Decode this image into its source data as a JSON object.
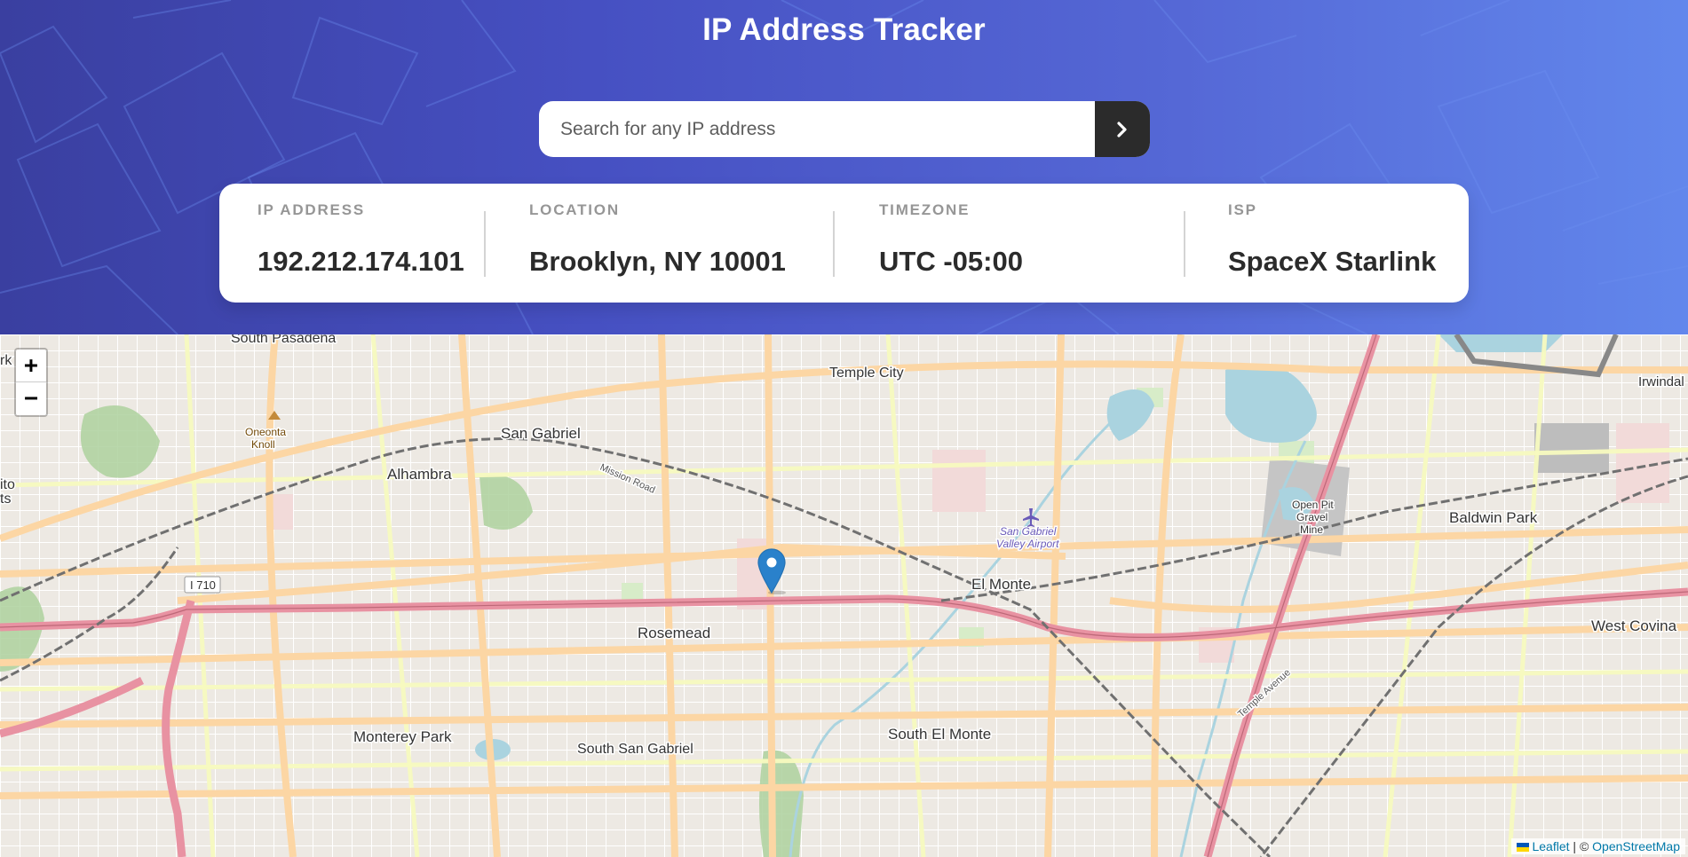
{
  "header": {
    "title": "IP Address Tracker",
    "search": {
      "placeholder": "Search for any IP address",
      "value": ""
    }
  },
  "stats": {
    "ip": {
      "label": "IP ADDRESS",
      "value": "192.212.174.101"
    },
    "location": {
      "label": "LOCATION",
      "value": "Brooklyn, NY 10001"
    },
    "timezone": {
      "label": "TIMEZONE",
      "value": "UTC -05:00"
    },
    "isp": {
      "label": "ISP",
      "value": "SpaceX Starlink"
    }
  },
  "map": {
    "zoom_in": "+",
    "zoom_out": "−",
    "places": {
      "south_pasadena": "South Pasadena",
      "temple_city": "Temple City",
      "irwindale": "Irwindal",
      "oneonta_knoll_1": "Oneonta",
      "oneonta_knoll_2": "Knoll",
      "san_gabriel": "San Gabriel",
      "alhambra": "Alhambra",
      "mission_road": "Mission Road",
      "san_gabriel_valley_airport_1": "San Gabriel",
      "san_gabriel_valley_airport_2": "Valley Airport",
      "open_pit_1": "Open Pit",
      "open_pit_2": "Gravel",
      "open_pit_3": "Mine",
      "baldwin_park": "Baldwin Park",
      "el_monte": "El Monte",
      "rosemead": "Rosemead",
      "west_covina": "West Covina",
      "monterey_park": "Monterey Park",
      "south_san_gabriel": "South San Gabriel",
      "south_el_monte": "South El Monte",
      "temple_avenue": "Temple Avenue",
      "i710": "I 710",
      "left_edge_1": "rk",
      "left_edge_2": "ito",
      "left_edge_3": "ts"
    },
    "attribution": {
      "leaflet": "Leaflet",
      "separator": "| ©",
      "osm": "OpenStreetMap"
    },
    "colors": {
      "land": "#f2efe9",
      "major_road": "#fcd6a4",
      "highway": "#e892a2",
      "street": "#ffffff",
      "railway": "#707070",
      "water": "#aad3df",
      "park": "#add19e",
      "marker": "#2a81cb"
    }
  }
}
